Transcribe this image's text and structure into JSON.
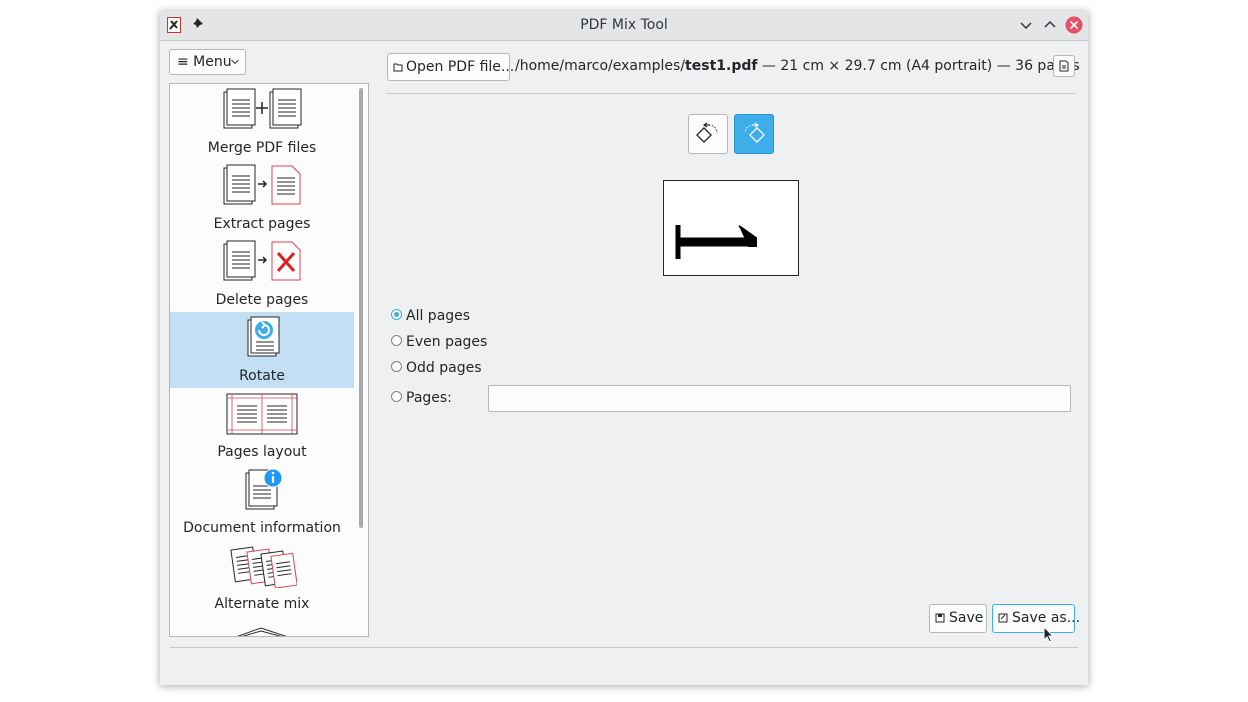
{
  "window": {
    "title": "PDF Mix Tool"
  },
  "menu": {
    "label": "≡ Menu"
  },
  "sidebar": {
    "items": [
      {
        "label": "Merge PDF files",
        "icon": "merge-icon"
      },
      {
        "label": "Extract pages",
        "icon": "extract-pages-icon"
      },
      {
        "label": "Delete pages",
        "icon": "delete-pages-icon"
      },
      {
        "label": "Rotate",
        "icon": "rotate-icon",
        "selected": true
      },
      {
        "label": "Pages layout",
        "icon": "pages-layout-icon"
      },
      {
        "label": "Document information",
        "icon": "info-icon"
      },
      {
        "label": "Alternate mix",
        "icon": "alternate-mix-icon"
      }
    ]
  },
  "toolbar": {
    "open_label": "Open PDF file...",
    "path_prefix": "/home/marco/examples/",
    "file_name": "test1.pdf",
    "file_info": " — 21 cm × 29.7 cm (A4 portrait) — 36 pages"
  },
  "rotate": {
    "options": [
      {
        "label": "All pages",
        "checked": true
      },
      {
        "label": "Even pages",
        "checked": false
      },
      {
        "label": "Odd pages",
        "checked": false
      },
      {
        "label": "Pages:",
        "checked": false
      }
    ],
    "pages_value": ""
  },
  "actions": {
    "save_label": "Save",
    "save_as_label": "Save as..."
  },
  "colors": {
    "accent": "#3daee9",
    "selection": "#c2dff3",
    "close": "#e95065"
  }
}
